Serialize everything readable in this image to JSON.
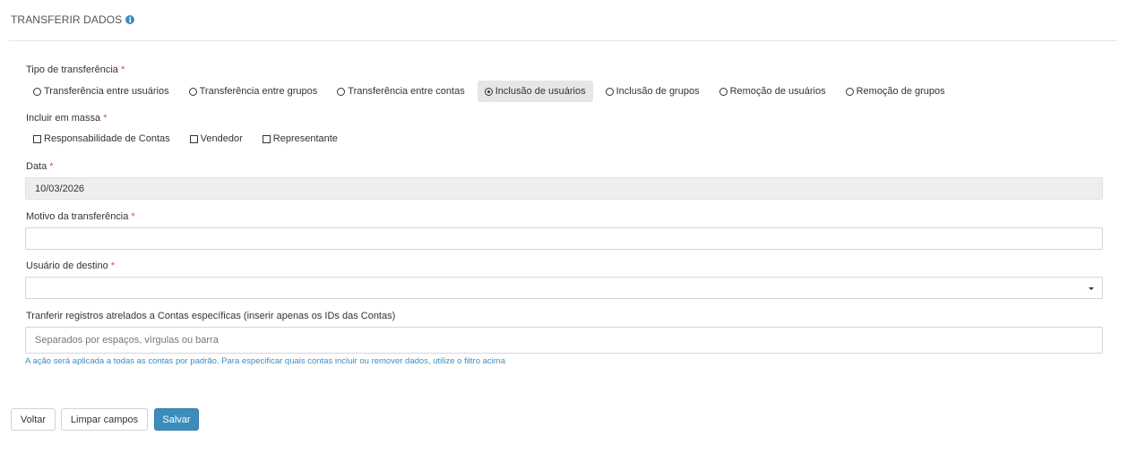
{
  "header": {
    "title": "TRANSFERIR DADOS",
    "info_icon": "info-icon",
    "info_glyph": "i"
  },
  "required_marker": "*",
  "transfer_type": {
    "label": "Tipo de transferência",
    "options": [
      "Transferência entre usuários",
      "Transferência entre grupos",
      "Transferência entre contas",
      "Inclusão de usuários",
      "Inclusão de grupos",
      "Remoção de usuários",
      "Remoção de grupos"
    ],
    "selected": "Inclusão de usuários"
  },
  "bulk_include": {
    "label": "Incluir em massa",
    "options": [
      "Responsabilidade de Contas",
      "Vendedor",
      "Representante"
    ]
  },
  "date": {
    "label": "Data",
    "value": "10/03/2026"
  },
  "reason": {
    "label": "Motivo da transferência",
    "value": ""
  },
  "destination_user": {
    "label": "Usuário de destino",
    "value": ""
  },
  "accounts": {
    "label": "Tranferir registros atrelados a Contas específicas (inserir apenas os IDs das Contas)",
    "placeholder": "Separados por espaços, vírgulas ou barra",
    "help": "A ação será aplicada a todas as contas por padrão. Para especificar quais contas incluir ou remover dados, utilize o filtro acima"
  },
  "buttons": {
    "back": "Voltar",
    "clear": "Limpar campos",
    "save": "Salvar"
  },
  "colors": {
    "accent": "#3c8dbc",
    "required": "#d9534f",
    "disabled_bg": "#eeeeee"
  }
}
